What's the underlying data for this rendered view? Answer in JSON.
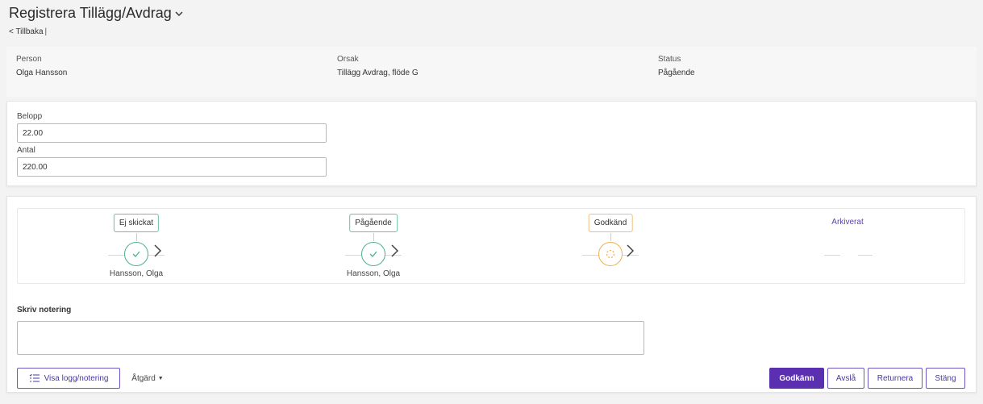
{
  "header": {
    "title": "Registrera Tillägg/Avdrag",
    "back_label": "< Tillbaka",
    "back_separator": "|"
  },
  "info": {
    "person_label": "Person",
    "person_value": "Olga Hansson",
    "reason_label": "Orsak",
    "reason_value": "Tillägg Avdrag, flöde G",
    "status_label": "Status",
    "status_value": "Pågående"
  },
  "form": {
    "amount_label": "Belopp",
    "amount_value": "22.00",
    "count_label": "Antal",
    "count_value": "220.00"
  },
  "workflow": {
    "steps": [
      {
        "label": "Ej skickat",
        "state": "done",
        "person": "Hansson, Olga"
      },
      {
        "label": "Pågående",
        "state": "done",
        "person": "Hansson, Olga"
      },
      {
        "label": "Godkänd",
        "state": "in-progress",
        "person": ""
      },
      {
        "label": "Arkiverat",
        "state": "not-started",
        "person": ""
      }
    ],
    "colors": {
      "done": "#4cb28f",
      "pending": "#efb150",
      "accent": "#5a2fb0"
    }
  },
  "note": {
    "label": "Skriv notering",
    "value": ""
  },
  "actions": {
    "log_label": "Visa logg/notering",
    "action_label": "Åtgärd",
    "approve_label": "Godkänn",
    "reject_label": "Avslå",
    "return_label": "Returnera",
    "close_label": "Stäng"
  }
}
